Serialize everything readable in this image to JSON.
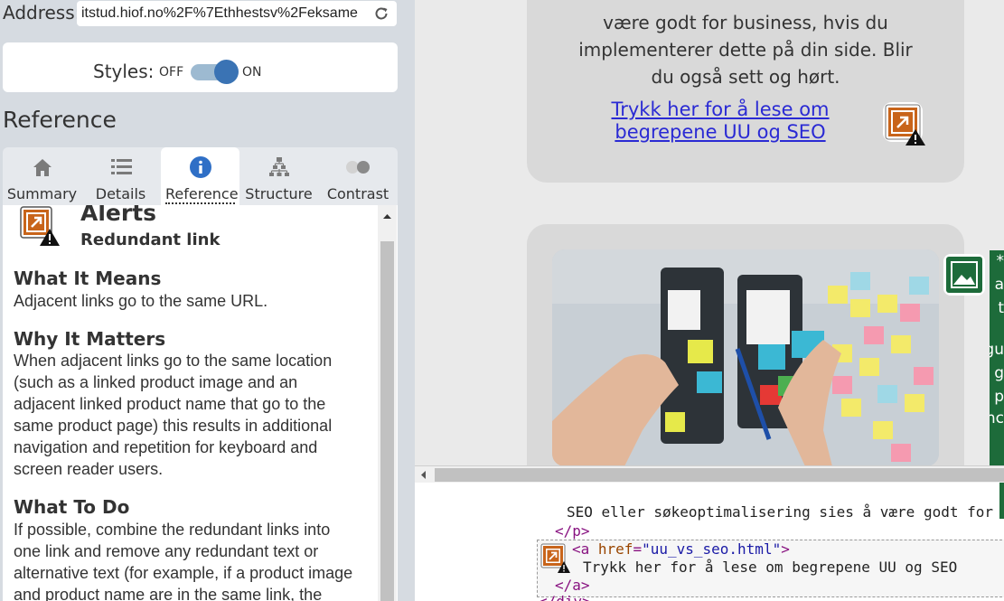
{
  "address": {
    "label": "Address:",
    "value": "itstud.hiof.no%2F%7Ethhestsv%2Feksame"
  },
  "styles": {
    "label": "Styles:",
    "off_label": "OFF",
    "on_label": "ON",
    "state": "on"
  },
  "section_heading": "Reference",
  "tabs": [
    {
      "label": "Summary",
      "icon": "home-icon"
    },
    {
      "label": "Details",
      "icon": "list-icon"
    },
    {
      "label": "Reference",
      "icon": "info-icon",
      "active": true
    },
    {
      "label": "Structure",
      "icon": "hierarchy-icon"
    },
    {
      "label": "Contrast",
      "icon": "contrast-icon"
    }
  ],
  "reference": {
    "category": "Alerts",
    "item": "Redundant link",
    "what_it_means": {
      "heading": "What It Means",
      "lines": [
        "Adjacent links go to the same URL."
      ]
    },
    "why_it_matters": {
      "heading": "Why It Matters",
      "lines": [
        "When adjacent links go to the same location",
        "(such as a linked product image and an",
        "adjacent linked product name that go to the",
        "same product page) this results in additional",
        "navigation and repetition for keyboard and",
        "screen reader users."
      ]
    },
    "what_to_do": {
      "heading": "What To Do",
      "lines": [
        "If possible, combine the redundant links into",
        "one link and remove any redundant text or",
        "alternative text (for example, if a product image",
        "and product name are in the same link, the"
      ]
    }
  },
  "preview": {
    "card1_lines": [
      "være godt for business, hvis du",
      "implementerer dette på din side. Blir",
      "du også sett og hørt."
    ],
    "card1_link_lines": [
      "Trykk her for å lese om",
      "begrepene UU og SEO"
    ],
    "green_strip_text": [
      "*",
      "a",
      "t",
      "",
      "gu",
      "g",
      "p",
      "nc"
    ]
  },
  "code": {
    "line1": "SEO eller søkeoptimalisering sies å være godt for",
    "line2_tag": "</p>",
    "line3_open": "<a ",
    "line3_attr": "href",
    "line3_eq": "=",
    "line3_val": "\"uu_vs_seo.html\"",
    "line3_close": ">",
    "line4": "Trykk her for å lese om begrepene UU og SEO",
    "line5_tag": "</a>",
    "line6_tag": "</div>"
  },
  "colors": {
    "alert_orange": "#c8641a",
    "link_blue": "#2a2ad4",
    "toggle_blue": "#3a73b4",
    "green_badge": "#1d6b3a"
  }
}
